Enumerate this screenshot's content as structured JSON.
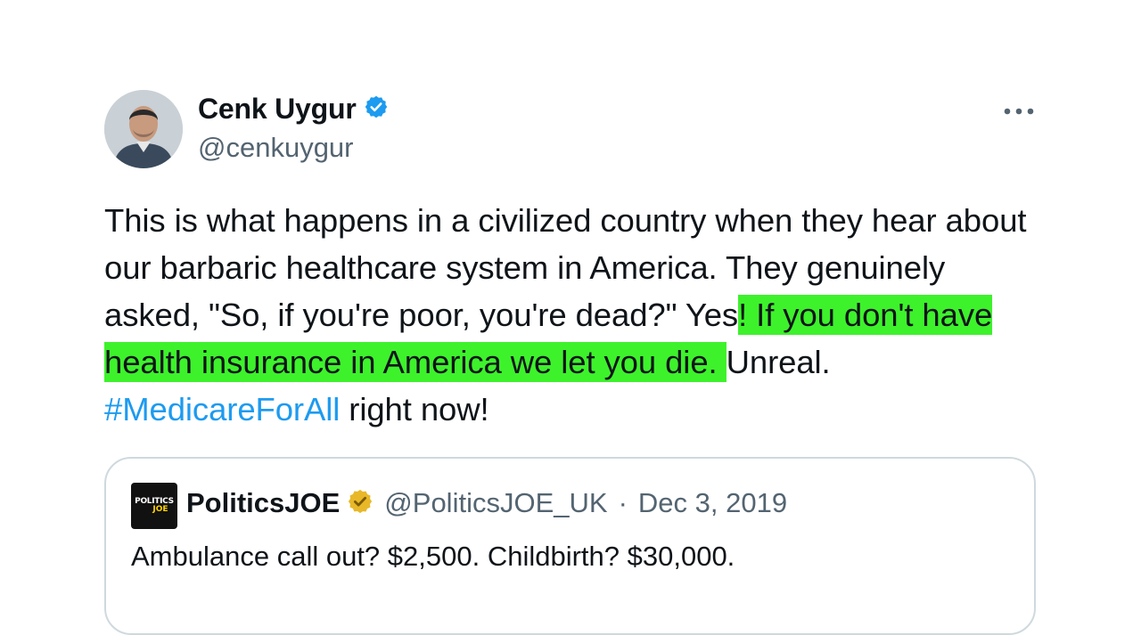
{
  "author": {
    "display_name": "Cenk Uygur",
    "handle": "@cenkuygur",
    "verified_badge_icon": "blue-verified-badge",
    "avatar": "profile-photo",
    "more_icon": "more-horizontal-icon"
  },
  "tweet": {
    "text_part1": "This is what happens in a civilized country when they hear about our barbaric healthcare system in America. They genuinely asked, \"So, if you're poor, you're dead?\" Yes",
    "text_highlighted": "! If you don't have health insurance in America we let you die. ",
    "text_part2": "Unreal. ",
    "hashtag": "#MedicareForAll",
    "text_part3": " right now!",
    "highlight_color": "#3df22b",
    "link_color": "#1d9bf0"
  },
  "quoted_tweet": {
    "logo_text_line1": "POLITICS",
    "logo_text_line2": "JOE",
    "display_name": "PoliticsJOE",
    "verified_badge_icon": "gold-verified-badge",
    "handle": "@PoliticsJOE_UK",
    "separator": "·",
    "date": "Dec 3, 2019",
    "text": "Ambulance call out? $2,500. Childbirth? $30,000."
  }
}
